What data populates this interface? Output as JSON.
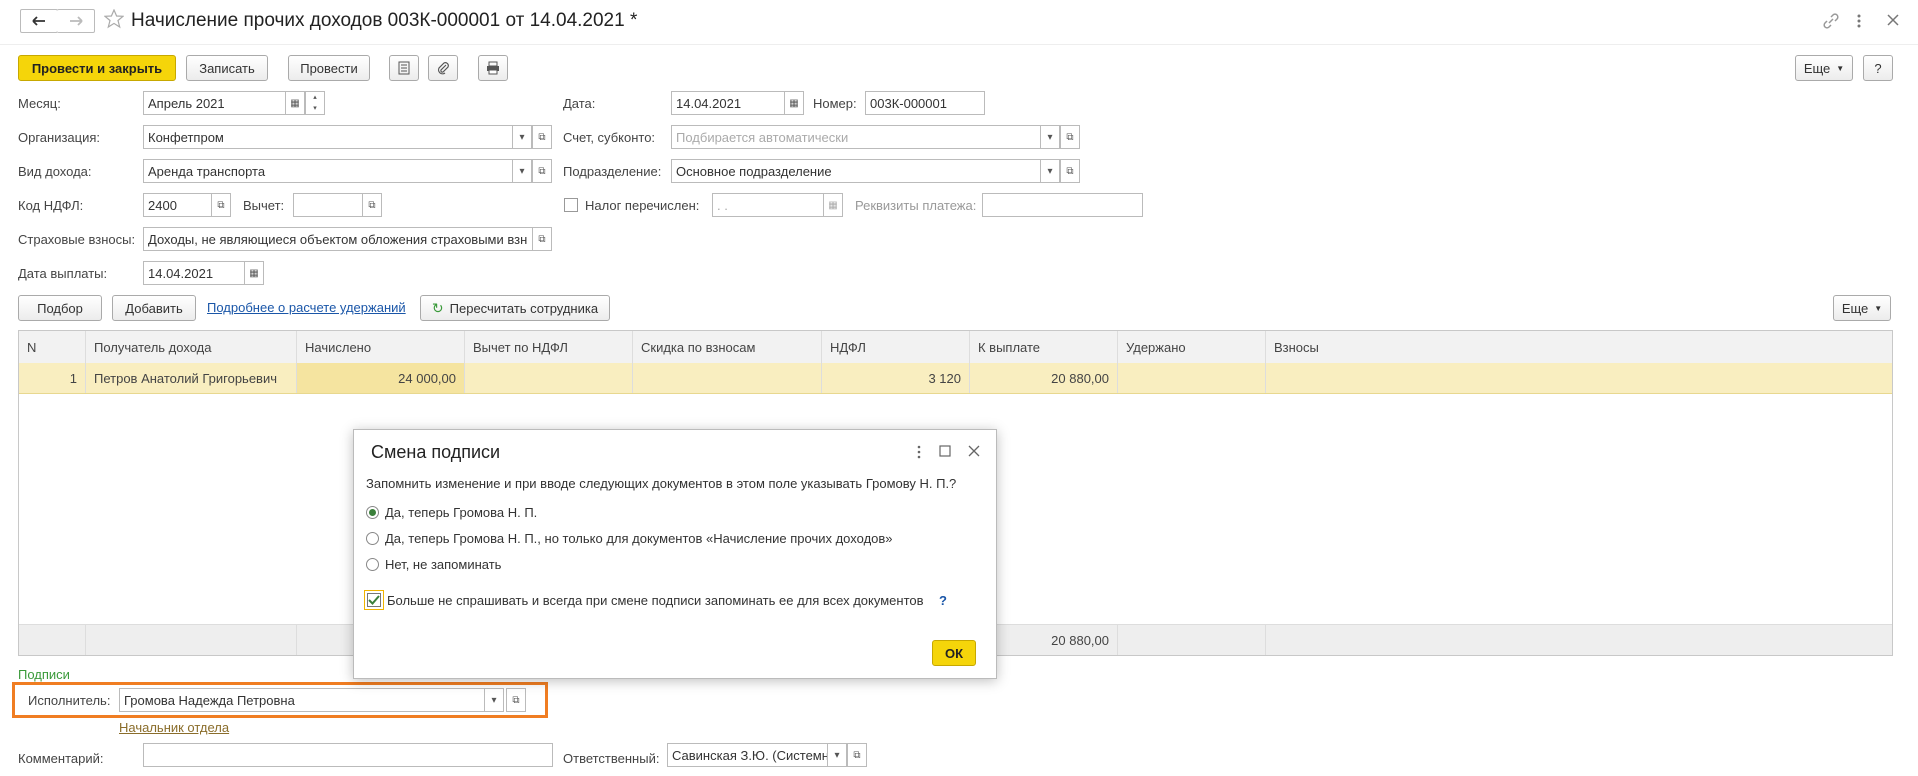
{
  "window": {
    "title": "Начисление прочих доходов 003К-000001 от 14.04.2021 *",
    "back_icon": "arrow-left-icon",
    "forward_icon": "arrow-right-icon",
    "star_icon": "star-icon"
  },
  "toolbar": {
    "post_close": "Провести и закрыть",
    "save": "Записать",
    "post": "Провести",
    "more": "Еще",
    "help": "?"
  },
  "form": {
    "month_label": "Месяц:",
    "month_value": "Апрель 2021",
    "date_label": "Дата:",
    "date_value": "14.04.2021",
    "number_label": "Номер:",
    "number_value": "003К-000001",
    "org_label": "Организация:",
    "org_value": "Конфетпром",
    "account_label": "Счет, субконто:",
    "account_placeholder": "Подбирается автоматически",
    "income_label": "Вид дохода:",
    "income_value": "Аренда транспорта",
    "dept_label": "Подразделение:",
    "dept_value": "Основное подразделение",
    "ndfl_code_label": "Код НДФЛ:",
    "ndfl_code_value": "2400",
    "deduction_label": "Вычет:",
    "deduction_value": "",
    "tax_paid_label": "Налог перечислен:",
    "tax_paid_date": " .  .",
    "payment_details_label": "Реквизиты платежа:",
    "insurance_label": "Страховые взносы:",
    "insurance_value": "Доходы, не являющиеся объектом обложения страховыми взн",
    "pay_date_label": "Дата выплаты:",
    "pay_date_value": "14.04.2021"
  },
  "table_toolbar": {
    "select": "Подбор",
    "add": "Добавить",
    "details_link": "Подробнее о расчете удержаний",
    "recalc": "Пересчитать сотрудника",
    "more": "Еще"
  },
  "table": {
    "columns": [
      "N",
      "Получатель дохода",
      "Начислено",
      "Вычет по НДФЛ",
      "Скидка по взносам",
      "НДФЛ",
      "К выплате",
      "Удержано",
      "Взносы"
    ],
    "rows": [
      [
        "1",
        "Петров Анатолий Григорьевич",
        "24 000,00",
        "",
        "",
        "3 120",
        "20 880,00",
        "",
        ""
      ]
    ],
    "footer_total": "20 880,00"
  },
  "signatures": {
    "section_label": "Подписи",
    "executor_label": "Исполнитель:",
    "executor_value": "Громова Надежда Петровна",
    "position_link": "Начальник отдела"
  },
  "bottom": {
    "comment_label": "Комментарий:",
    "responsible_label": "Ответственный:",
    "responsible_value": "Савинская З.Ю. (Системный"
  },
  "dialog": {
    "title": "Смена подписи",
    "question": "Запомнить изменение и при вводе следующих документов в этом поле указывать Громову Н. П.?",
    "options": [
      "Да, теперь Громова Н. П.",
      "Да, теперь Громова Н. П., но только для документов «Начисление прочих доходов»",
      "Нет, не запоминать"
    ],
    "selected_option": 0,
    "checkbox_label": "Больше не спрашивать и всегда при смене подписи запоминать ее для всех документов",
    "checkbox_checked": true,
    "help": "?",
    "ok": "ОК"
  },
  "colors": {
    "primary_button": "#f5d50a",
    "selected_row": "#f9eec0",
    "highlight_frame": "#f07d22",
    "signatures_label": "#3a9a3a",
    "link": "#1a56a8"
  }
}
